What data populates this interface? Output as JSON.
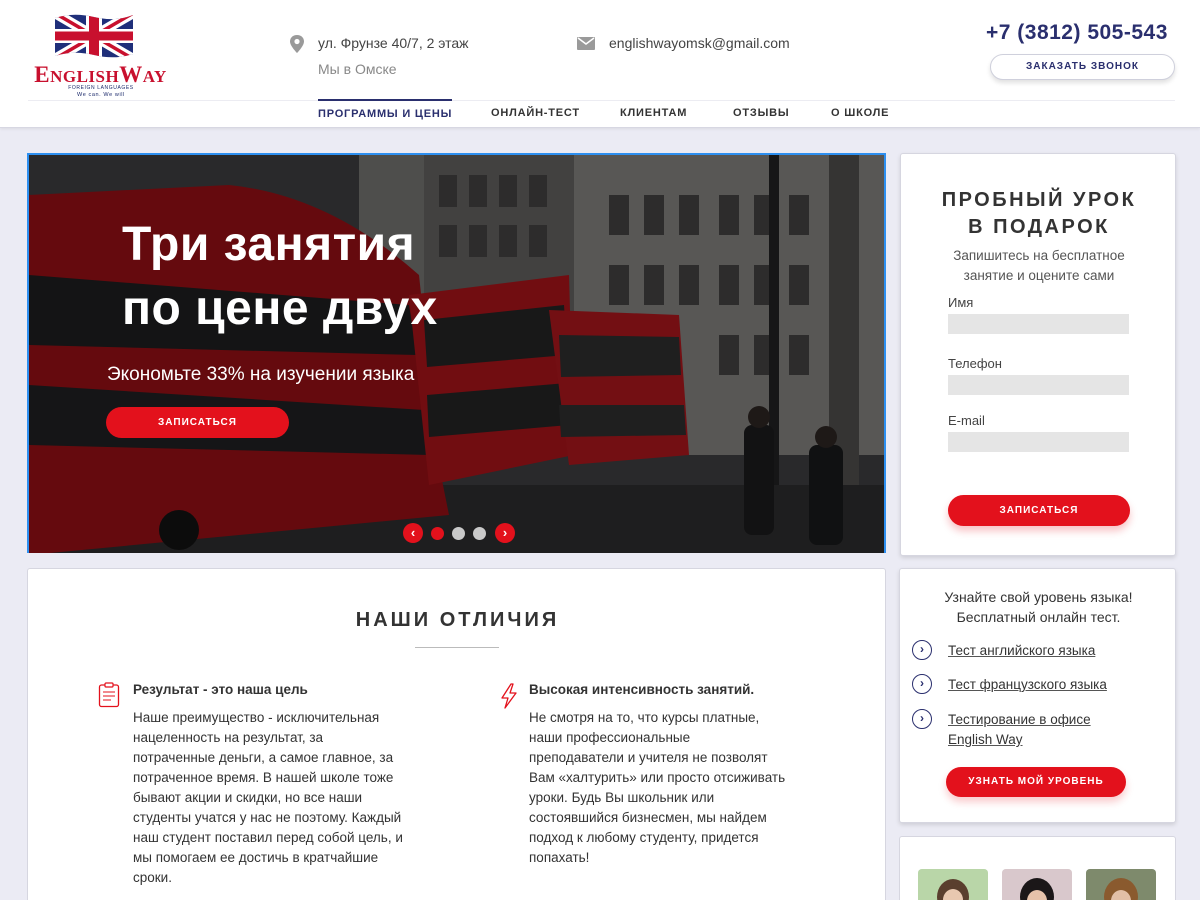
{
  "brand": {
    "name_first": "E",
    "name_rest": "NGLISH",
    "name_w": "W",
    "name_ay": "AY",
    "sub1": "FOREIGN LANGUAGES",
    "sub2": "We can. We will"
  },
  "contacts": {
    "address": "ул. Фрунзе 40/7,  2 этаж",
    "city": "Мы в Омске",
    "email": "englishwayomsk@gmail.com",
    "phone": "+7 (3812) 505-543",
    "callback_label": "ЗАКАЗАТЬ ЗВОНОК"
  },
  "nav": {
    "items": [
      "ПРОГРАММЫ И ЦЕНЫ",
      "ОНЛАЙН-ТЕСТ",
      "КЛИЕНТАМ",
      "ОТЗЫВЫ",
      "О ШКОЛЕ"
    ],
    "active_index": 0
  },
  "hero": {
    "title_line1": "Три занятия",
    "title_line2": "по цене двух",
    "subtitle": "Экономьте 33% на изучении языка",
    "button": "ЗАПИСАТЬСЯ",
    "prev_arrow": "‹",
    "next_arrow": "›",
    "slide_count": 3,
    "active_slide": 0
  },
  "trial": {
    "title_line1": "ПРОБНЫЙ УРОК",
    "title_line2": "В ПОДАРОК",
    "subtitle": "Запишитесь на бесплатное занятие и оцените сами",
    "name_label": "Имя",
    "phone_label": "Телефон",
    "email_label": "E-mail",
    "name_value": "",
    "phone_value": "",
    "email_value": "",
    "button": "ЗАПИСАТЬСЯ"
  },
  "differences": {
    "title": "НАШИ  ОТЛИЧИЯ",
    "features": [
      {
        "icon": "clipboard-icon",
        "title": "Результат - это наша цель",
        "text": "Наше преимущество - исключительная нацеленность на результат, за потраченные деньги, а самое главное, за потраченное время. В нашей школе тоже бывают акции и скидки, но все наши студенты учатся у нас не поэтому. Каждый наш студент поставил перед собой цель, и мы помогаем ее достичь в кратчайшие сроки."
      },
      {
        "icon": "lightning-icon",
        "title": "Высокая интенсивность занятий.",
        "text": "Не смотря на то, что курсы платные, наши профессиональные преподаватели и учителя не позволят Вам «халтурить» или просто отсиживать уроки. Будь Вы школьник или состоявшийся бизнесмен, мы найдем подход к любому студенту, придется попахать!"
      }
    ]
  },
  "level_test": {
    "subtitle_line1": "Узнайте свой уровень языка!",
    "subtitle_line2": "Бесплатный онлайн тест.",
    "links": [
      "Тест английского языка",
      "Тест французского языка",
      "Тестирование в офисе English Way"
    ],
    "link_arrow": "›",
    "button": "УЗНАТЬ МОЙ УРОВЕНЬ"
  },
  "colors": {
    "accent_red": "#e3111c",
    "brand_navy": "#2a2f6e",
    "page_bg": "#ebebf4"
  }
}
